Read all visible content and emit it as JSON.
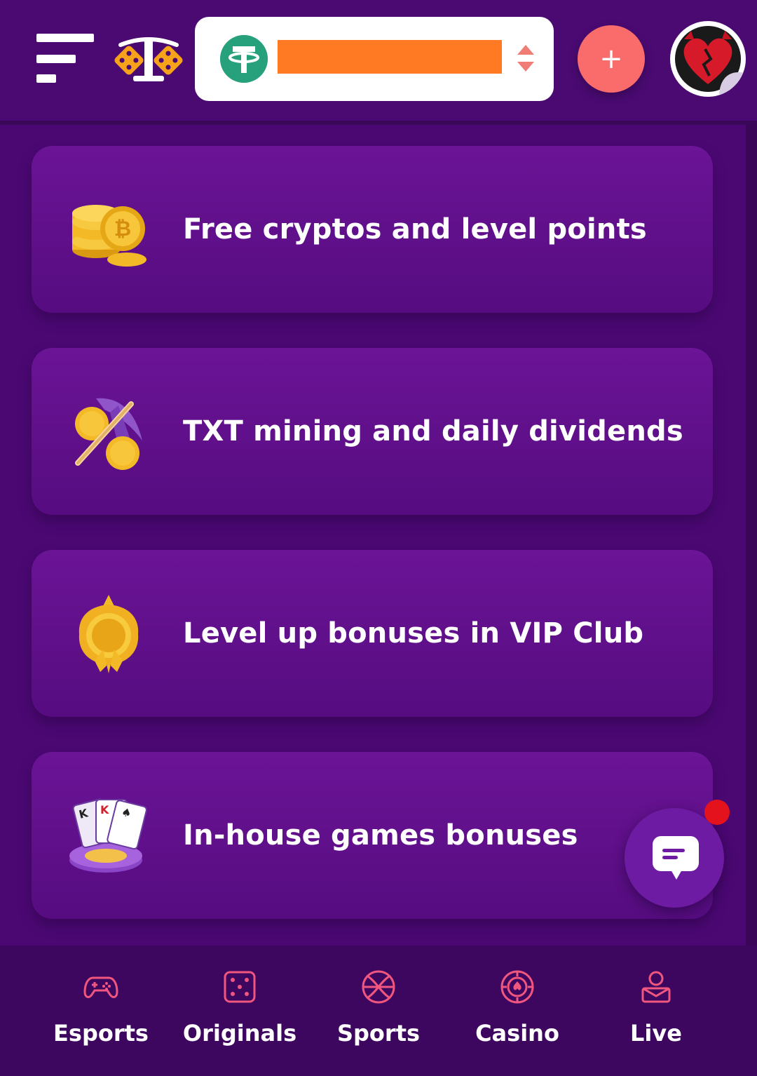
{
  "header": {
    "menu_icon": "hamburger-menu-icon",
    "logo_icon": "scales-dice-logo",
    "wallet": {
      "currency_icon": "tether-usdt-icon",
      "balance": "",
      "selector_icon": "up-down-arrows-icon"
    },
    "add_button": "+",
    "avatar_icon": "heart-shell-avatar"
  },
  "features": [
    {
      "label": "Free cryptos and level points",
      "icon": "gold-coins-bitcoin-icon"
    },
    {
      "label": "TXT mining and daily dividends",
      "icon": "pickaxe-coins-icon"
    },
    {
      "label": "Level up bonuses in VIP Club",
      "icon": "gold-medal-icon"
    },
    {
      "label": "In-house games bonuses",
      "icon": "cards-chip-icon"
    }
  ],
  "chat": {
    "icon": "chat-bubble-icon",
    "has_notification": true
  },
  "nav": [
    {
      "label": "Esports",
      "icon": "gamepad-icon"
    },
    {
      "label": "Originals",
      "icon": "dice-icon"
    },
    {
      "label": "Sports",
      "icon": "basketball-icon"
    },
    {
      "label": "Casino",
      "icon": "poker-chip-icon"
    },
    {
      "label": "Live",
      "icon": "live-dealer-icon"
    }
  ],
  "colors": {
    "background": "#4b0873",
    "card": "#6b1496",
    "accent": "#fa6c6c",
    "nav_icon": "#f0567e",
    "balance_bar": "#ff7a22"
  }
}
